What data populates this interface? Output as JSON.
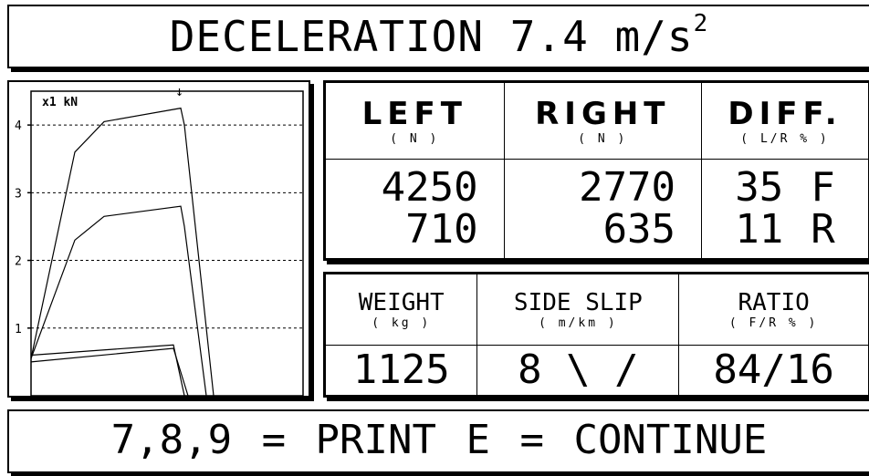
{
  "header": {
    "title": "DECELERATION 7.4 m/s",
    "superscript": "2"
  },
  "chart_data": {
    "type": "line",
    "ylabel": "x1 kN",
    "yticks": [
      "1",
      "2",
      "3",
      "4"
    ],
    "ylim": [
      0,
      4.5
    ],
    "marker": "↓",
    "grid": true,
    "series": [
      {
        "points": [
          [
            0,
            0.55
          ],
          [
            0.6,
            3.6
          ],
          [
            1,
            4.05
          ],
          [
            2.05,
            4.25
          ],
          [
            2.1,
            4.0
          ],
          [
            2.5,
            0
          ]
        ]
      },
      {
        "points": [
          [
            0,
            0.55
          ],
          [
            0.6,
            2.3
          ],
          [
            1,
            2.65
          ],
          [
            2.05,
            2.8
          ],
          [
            2.1,
            2.5
          ],
          [
            2.4,
            0
          ]
        ]
      },
      {
        "points": [
          [
            0,
            0.6
          ],
          [
            1.95,
            0.75
          ],
          [
            2.1,
            0
          ]
        ]
      },
      {
        "points": [
          [
            0,
            0.5
          ],
          [
            1.95,
            0.7
          ],
          [
            2.15,
            0
          ]
        ]
      }
    ]
  },
  "forces": {
    "left": {
      "label": "LEFT",
      "unit": "( N )",
      "v1": "4250",
      "v2": "710"
    },
    "right": {
      "label": "RIGHT",
      "unit": "( N )",
      "v1": "2770",
      "v2": "635"
    },
    "diff": {
      "label": "DIFF.",
      "unit": "( L/R % )",
      "v1": "35",
      "s1": "F",
      "v2": "11",
      "s2": "R"
    }
  },
  "info": {
    "weight": {
      "label": "WEIGHT",
      "unit": "( kg )",
      "value": "1125"
    },
    "side_slip": {
      "label": "SIDE SLIP",
      "unit": "( m/km )",
      "value": "8 \\ /"
    },
    "ratio": {
      "label": "RATIO",
      "unit": "( F/R % )",
      "value": "84/16"
    }
  },
  "footer": {
    "text": "7,8,9 = PRINT   E = CONTINUE"
  }
}
